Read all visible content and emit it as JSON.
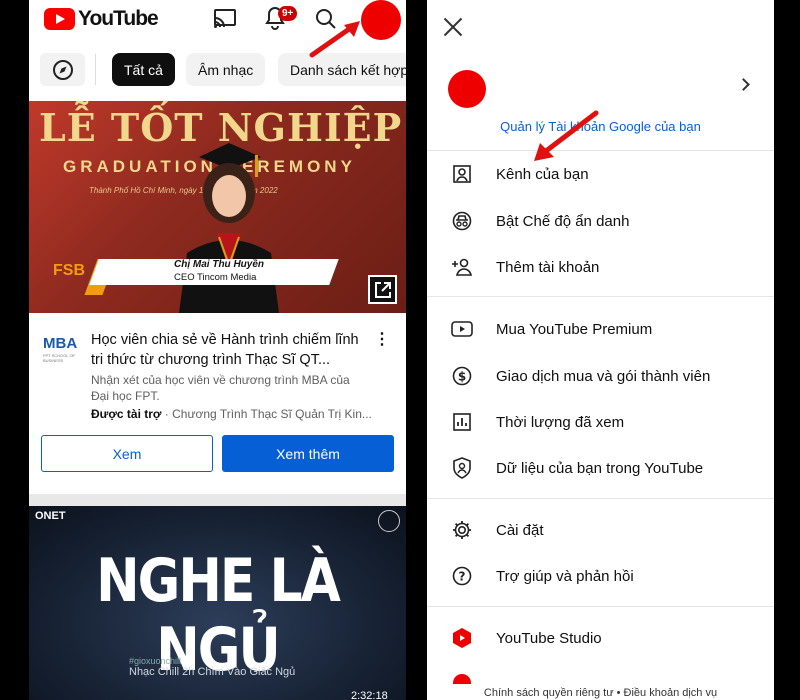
{
  "left": {
    "logo_text": "YouTube",
    "notification_badge": "9+",
    "chips": [
      "Tất cả",
      "Âm nhạc",
      "Danh sách kết hợp"
    ],
    "thumb1": {
      "title": "LỄ TỐT NGHIỆP",
      "subtitle": "GRADUATION CEREMONY",
      "place": "Thành Phố Hồ Chí Minh, ngày 11 tháng 11 năm 2022",
      "brand": "FSB",
      "name": "Chị Mai Thu Huyền",
      "role": "CEO Tincom Media"
    },
    "ad": {
      "logo": "MBA",
      "logo_sub": "FPT SCHOOL OF BUSINESS",
      "title": "Học viên chia sẻ về Hành trình chiếm lĩnh tri thức từ chương trình Thạc Sĩ QT...",
      "desc": "Nhận xét của học viên về chương trình MBA của Đại học FPT.",
      "sponsored": "Được tài trợ",
      "advertiser": "· Chương Trình Thạc Sĩ Quản Trị Kin...",
      "btn_view": "Xem",
      "btn_more": "Xem thêm"
    },
    "thumb2": {
      "channel": "ONET",
      "big_text": "NGHE LÀ NGỦ",
      "hashtag": "#gioxuonchill",
      "caption": "Nhạc Chill 2h Chìm Vào Giấc Ngủ",
      "time": "2:32:18"
    }
  },
  "right": {
    "manage_account": "Quản lý Tài khoản Google của bạn",
    "menu": [
      {
        "label": "Kênh của bạn",
        "icon": "person-icon"
      },
      {
        "label": "Bật Chế độ ẩn danh",
        "icon": "incognito-icon"
      },
      {
        "label": "Thêm tài khoản",
        "icon": "add-person-icon"
      },
      {
        "label": "Mua YouTube Premium",
        "icon": "youtube-icon"
      },
      {
        "label": "Giao dịch mua và gói thành viên",
        "icon": "dollar-icon"
      },
      {
        "label": "Thời lượng đã xem",
        "icon": "bar-chart-icon"
      },
      {
        "label": "Dữ liệu của bạn trong YouTube",
        "icon": "shield-person-icon"
      },
      {
        "label": "Cài đặt",
        "icon": "gear-icon"
      },
      {
        "label": "Trợ giúp và phản hồi",
        "icon": "help-icon"
      },
      {
        "label": "YouTube Studio",
        "icon": "youtube-studio-icon"
      }
    ],
    "footer": "Chính sách quyền riêng tư  •  Điều khoản dịch vụ"
  },
  "colors": {
    "accent_red": "#ee0000",
    "link_blue": "#065fd4",
    "arrow_red": "#e01010"
  }
}
